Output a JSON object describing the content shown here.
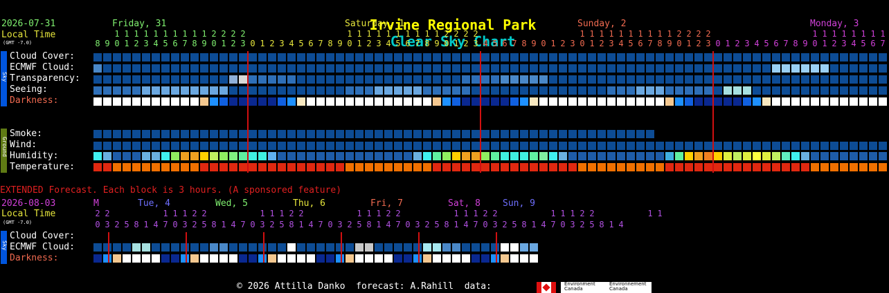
{
  "title": {
    "place": "Irvine Regional Park",
    "chart": "Clear Sky Chart"
  },
  "main": {
    "date": "2026-07-31",
    "local_time": "Local Time",
    "gmt": "(GMT -7.0)",
    "days": [
      {
        "label": "Friday, 31",
        "color": "#7fef6f"
      },
      {
        "label": "Saturday, 1",
        "color": "#e6e63c"
      },
      {
        "label": "Sunday, 2",
        "color": "#f06a50"
      },
      {
        "label": "Monday, 3",
        "color": "#d040d8"
      }
    ],
    "hours_top": "1111111111112222 1111111111112222 1111111111112222 1111111",
    "hours_bottom": "8901234567890123012345678901234567890123456789012301234567890123012345678901234567",
    "sky_tag": "Sky",
    "ground_tag": "Ground",
    "rows": [
      "Cloud Cover:",
      "ECMWF Cloud:",
      "Transparency:",
      "Seeing:",
      "Darkness:"
    ],
    "ground_rows": [
      "Smoke:",
      "Wind:",
      "Humidity:",
      "Temperature:"
    ]
  },
  "extended": {
    "notice": "EXTENDED Forecast. Each block is 3 hours. (A sponsored feature)",
    "date": "2026-08-03",
    "local_time": "Local Time",
    "gmt": "(GMT -7.0)",
    "days": [
      {
        "label": "M",
        "color": "#d040d8"
      },
      {
        "label": "Tue, 4",
        "color": "#6f6fff"
      },
      {
        "label": "Wed, 5",
        "color": "#7fef6f"
      },
      {
        "label": "Thu, 6",
        "color": "#e6e63c"
      },
      {
        "label": "Fri, 7",
        "color": "#f06a50"
      },
      {
        "label": "Sat, 8",
        "color": "#d040d8"
      },
      {
        "label": "Sun, 9",
        "color": "#6f6fff"
      }
    ],
    "hours_1": "22     11122     11122     11122     11122     11122     11",
    "hours_2": "0325814703258147032581470325814703258147032581470325814",
    "sky_tag": "Sky",
    "rows": [
      "Cloud Cover:",
      "ECMWF Cloud:",
      "Darkness:"
    ]
  },
  "footer": {
    "credit": "© 2026 Attilla Danko  forecast: A.Rahill  data:",
    "logo_en": "Environment Canada",
    "logo_fr": "Environnement Canada"
  },
  "colors": {
    "title_place": "#ffff00",
    "title_chart": "#00c8c8",
    "label_date": "#7fef6f",
    "label_local": "#e6e63c",
    "label_darkness": "#f06a50",
    "grid_line": "#d11010",
    "sky_tab": "#0066ff",
    "ground_tab": "#6b7f1a"
  }
}
